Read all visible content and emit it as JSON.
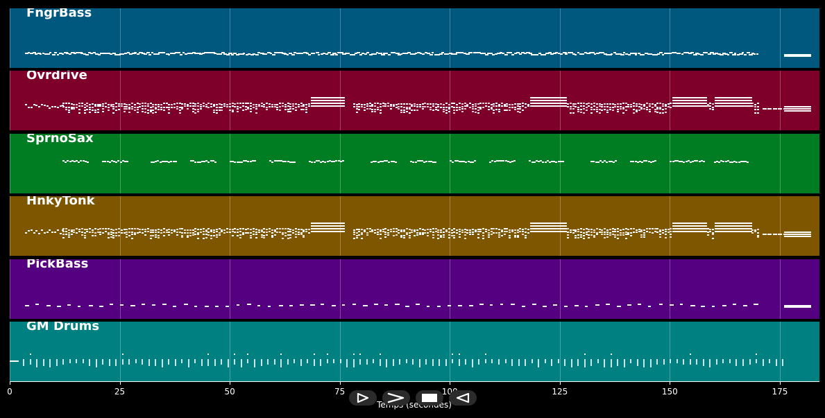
{
  "tracks": [
    {
      "name": "FngrBass",
      "color": "#00587f",
      "pattern": "bass"
    },
    {
      "name": "Ovrdrive",
      "color": "#7e002a",
      "pattern": "chords"
    },
    {
      "name": "SprnoSax",
      "color": "#007c22",
      "pattern": "sax"
    },
    {
      "name": "HnkyTonk",
      "color": "#7e5600",
      "pattern": "chords"
    },
    {
      "name": "PickBass",
      "color": "#550080",
      "pattern": "sparse"
    },
    {
      "name": "GM Drums",
      "color": "#008080",
      "pattern": "drums"
    }
  ],
  "x_axis": {
    "label": "Temps (secondes)",
    "ticks": [
      "0",
      "25",
      "50",
      "75",
      "100",
      "125",
      "150",
      "175"
    ],
    "tick_values": [
      0,
      25,
      50,
      75,
      100,
      125,
      150,
      175
    ],
    "max": 184
  },
  "controls": [
    {
      "name": "play-outline-icon"
    },
    {
      "name": "fast-forward-icon"
    },
    {
      "name": "stop-icon"
    },
    {
      "name": "rewind-icon"
    }
  ]
}
